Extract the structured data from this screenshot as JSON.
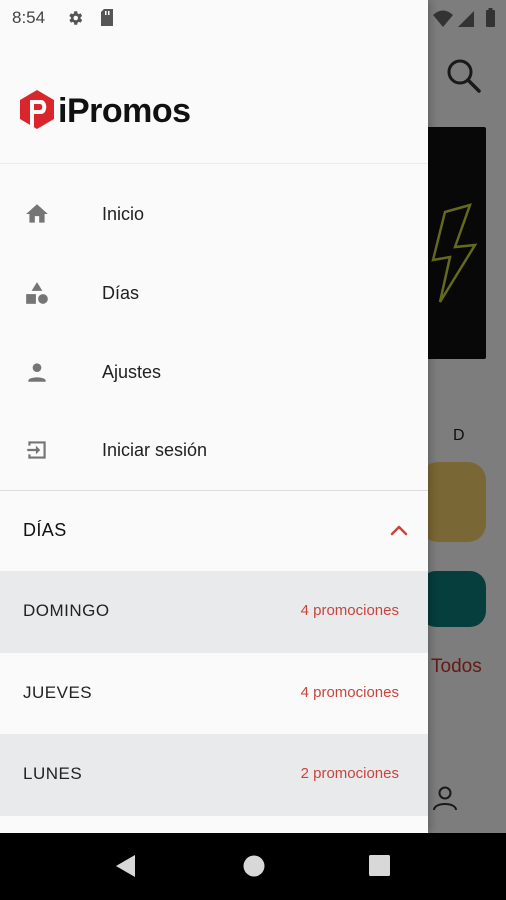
{
  "status_bar": {
    "time": "8:54",
    "icons": [
      "gear-icon",
      "sd-card-icon",
      "wifi-icon",
      "signal-icon",
      "battery-icon"
    ]
  },
  "drawer": {
    "logo_text": "iPromos",
    "menu": [
      {
        "icon": "home-icon",
        "label": "Inicio"
      },
      {
        "icon": "shapes-icon",
        "label": "Días"
      },
      {
        "icon": "person-icon",
        "label": "Ajustes"
      },
      {
        "icon": "login-icon",
        "label": "Iniciar sesión"
      }
    ],
    "days_section": {
      "title": "DÍAS",
      "expanded": true,
      "days": [
        {
          "name": "DOMINGO",
          "count": "4 promociones"
        },
        {
          "name": "JUEVES",
          "count": "4 promociones"
        },
        {
          "name": "LUNES",
          "count": "2 promociones"
        }
      ]
    }
  },
  "background": {
    "day_letter": "D",
    "todos_label": "Todos"
  },
  "colors": {
    "accent": "#c8453d",
    "brand_red": "#d9262c",
    "shaded_row": "#e9eaec"
  }
}
